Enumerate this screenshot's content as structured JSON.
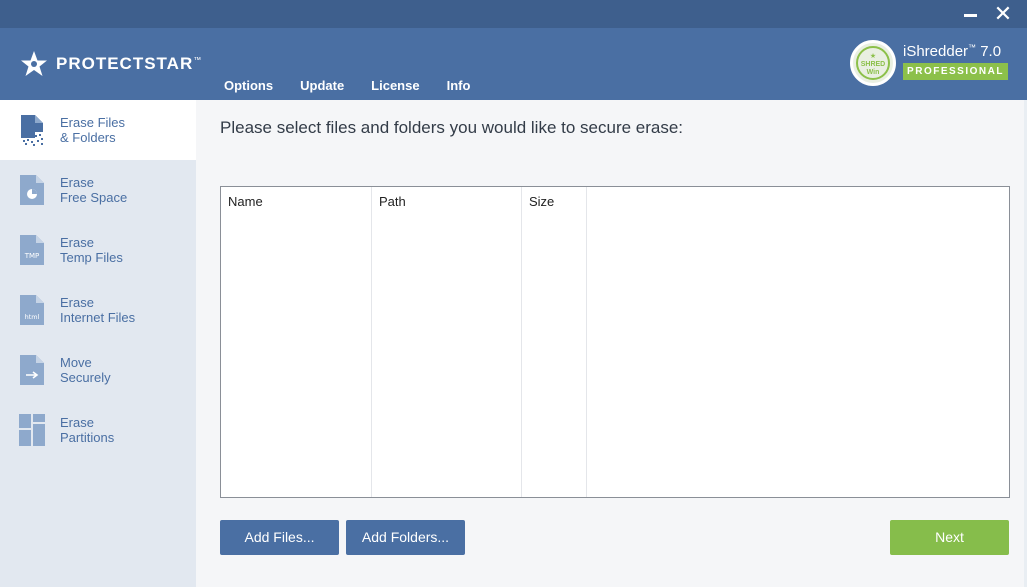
{
  "window": {
    "minimize_icon": "minimize-icon",
    "close_glyph": "✕"
  },
  "header": {
    "logo_text": "PROTECTSTAR",
    "logo_tm": "™",
    "menu": [
      {
        "label": "Options"
      },
      {
        "label": "Update"
      },
      {
        "label": "License"
      },
      {
        "label": "Info"
      }
    ],
    "product_name": "iShredder",
    "product_tm": "™",
    "product_version": "7.0",
    "edition": "PROFESSIONAL",
    "seal_text": "SHRED",
    "seal_sub": "Win",
    "accent_color": "#8cc04a",
    "header_color": "#4a6fa3"
  },
  "sidebar": {
    "items": [
      {
        "label": "Erase Files\n& Folders",
        "icon": "erase-files-icon",
        "active": true
      },
      {
        "label": "Erase\nFree Space",
        "icon": "free-space-icon",
        "active": false
      },
      {
        "label": "Erase\nTemp Files",
        "icon": "temp-files-icon",
        "active": false,
        "icon_text": "TMP"
      },
      {
        "label": "Erase\nInternet Files",
        "icon": "internet-files-icon",
        "active": false,
        "icon_text": "html"
      },
      {
        "label": "Move\nSecurely",
        "icon": "move-securely-icon",
        "active": false
      },
      {
        "label": "Erase\nPartitions",
        "icon": "partitions-icon",
        "active": false
      }
    ]
  },
  "main": {
    "prompt": "Please select files and folders you would like to secure erase:",
    "table": {
      "columns": [
        {
          "label": "Name"
        },
        {
          "label": "Path"
        },
        {
          "label": "Size"
        }
      ],
      "rows": []
    },
    "buttons": {
      "add_files": "Add Files...",
      "add_folders": "Add Folders...",
      "next": "Next"
    }
  }
}
